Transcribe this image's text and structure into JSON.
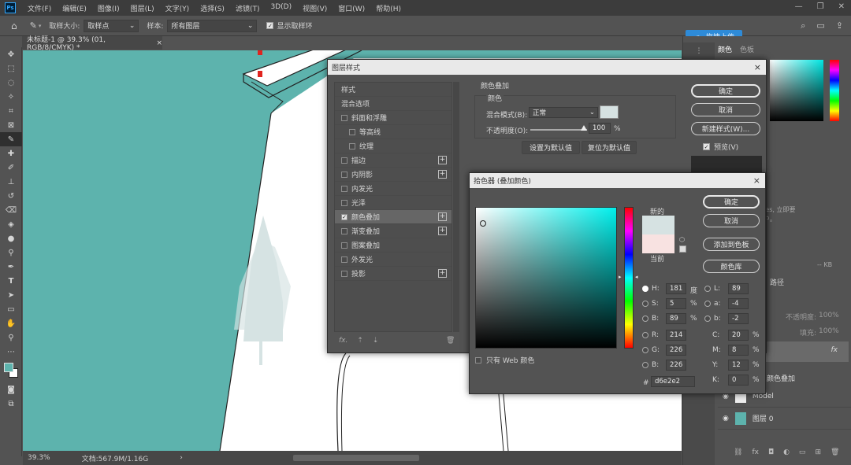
{
  "menubar": {
    "logo": "Ps",
    "items": [
      "文件(F)",
      "编辑(E)",
      "图像(I)",
      "图层(L)",
      "文字(Y)",
      "选择(S)",
      "滤镜(T)",
      "3D(D)",
      "视图(V)",
      "窗口(W)",
      "帮助(H)"
    ]
  },
  "options": {
    "size_label": "取样大小:",
    "size_value": "取样点",
    "sample_label": "样本:",
    "sample_value": "所有图层",
    "show_ring": "显示取样环"
  },
  "cloud_button": "拖拽上传",
  "doc_tab": {
    "title": "未标题-1 @ 39.3% (01, RGB/8/CMYK) *",
    "close": "×"
  },
  "status": {
    "zoom": "39.3%",
    "doc": "文档:567.9M/1.16G",
    "arrow": "›"
  },
  "right": {
    "tab_color": "颜色",
    "tab_swatch": "色板",
    "cloud_text1": "e Cloud Libraries, 立即要",
    "cloud_text2": "ative Cloud 帐户。",
    "kb": "-- KB",
    "paths_tab": "路径",
    "opacity_label": "不透明度:",
    "fill_label": "填充:",
    "pct": "100%",
    "effect_label": "颜色叠加",
    "layer_model": "Model",
    "layer_0": "图层 0",
    "fx": "fx"
  },
  "layer_style": {
    "title": "图层样式",
    "close": "×",
    "items": [
      {
        "label": "样式",
        "check": false,
        "plus": false,
        "indent": 0,
        "nocb": true
      },
      {
        "label": "混合选项",
        "check": false,
        "plus": false,
        "indent": 0,
        "nocb": true
      },
      {
        "label": "斜面和浮雕",
        "check": false,
        "plus": false,
        "indent": 0
      },
      {
        "label": "等高线",
        "check": false,
        "plus": false,
        "indent": 1
      },
      {
        "label": "纹理",
        "check": false,
        "plus": false,
        "indent": 1
      },
      {
        "label": "描边",
        "check": false,
        "plus": true,
        "indent": 0
      },
      {
        "label": "内阴影",
        "check": false,
        "plus": true,
        "indent": 0
      },
      {
        "label": "内发光",
        "check": false,
        "plus": false,
        "indent": 0
      },
      {
        "label": "光泽",
        "check": false,
        "plus": false,
        "indent": 0
      },
      {
        "label": "颜色叠加",
        "check": true,
        "plus": true,
        "indent": 0,
        "active": true
      },
      {
        "label": "渐变叠加",
        "check": false,
        "plus": true,
        "indent": 0
      },
      {
        "label": "图案叠加",
        "check": false,
        "plus": false,
        "indent": 0
      },
      {
        "label": "外发光",
        "check": false,
        "plus": false,
        "indent": 0
      },
      {
        "label": "投影",
        "check": false,
        "plus": true,
        "indent": 0
      }
    ],
    "group_title": "颜色叠加",
    "sub_title": "颜色",
    "blend_label": "混合模式(B):",
    "blend_value": "正常",
    "opacity_label": "不透明度(O):",
    "opacity_value": "100",
    "pct": "%",
    "set_default": "设置为默认值",
    "reset_default": "复位为默认值",
    "ok": "确定",
    "cancel": "取消",
    "new_style": "新建样式(W)...",
    "preview": "预览(V)",
    "fx": "fx."
  },
  "picker": {
    "title": "拾色器 (叠加颜色)",
    "close": "×",
    "new": "新的",
    "current": "当前",
    "ok": "确定",
    "cancel": "取消",
    "add_swatch": "添加到色板",
    "libraries": "颜色库",
    "web_only": "只有 Web 颜色",
    "H": {
      "label": "H:",
      "value": "181",
      "unit": "度"
    },
    "S": {
      "label": "S:",
      "value": "5",
      "unit": "%"
    },
    "B": {
      "label": "B:",
      "value": "89",
      "unit": "%"
    },
    "R": {
      "label": "R:",
      "value": "214"
    },
    "G": {
      "label": "G:",
      "value": "226"
    },
    "Bl": {
      "label": "B:",
      "value": "226"
    },
    "L": {
      "label": "L:",
      "value": "89"
    },
    "a": {
      "label": "a:",
      "value": "-4"
    },
    "b": {
      "label": "b:",
      "value": "-2"
    },
    "C": {
      "label": "C:",
      "value": "20",
      "unit": "%"
    },
    "M": {
      "label": "M:",
      "value": "8",
      "unit": "%"
    },
    "Y": {
      "label": "Y:",
      "value": "12",
      "unit": "%"
    },
    "K": {
      "label": "K:",
      "value": "0",
      "unit": "%"
    },
    "hex_label": "#",
    "hex": "d6e2e2",
    "new_color": "#d6e2e2",
    "current_color": "#f8e2e1"
  },
  "colors": {
    "canvas": "#5db3ad",
    "accent": "#31a8ff",
    "fg": "#5db3ad",
    "overlay": "#d6e2e2"
  }
}
